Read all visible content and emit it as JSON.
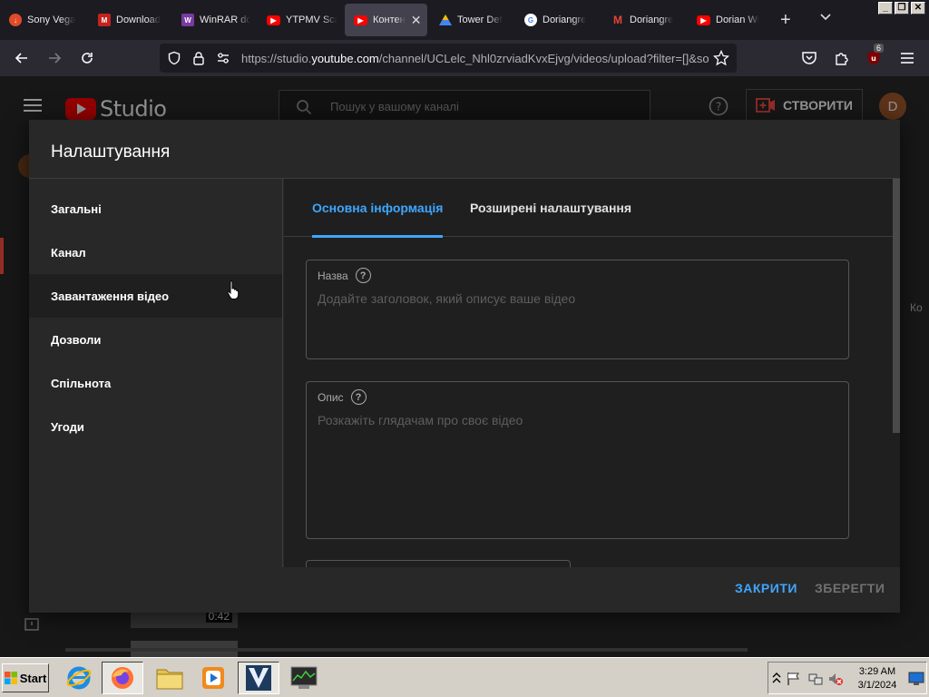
{
  "browser": {
    "tabs": [
      {
        "label": "Sony Vega",
        "fav_color": "#e04a2a",
        "fav_char": "↓"
      },
      {
        "label": "Download",
        "fav_color": "#c5221f",
        "fav_char": "M"
      },
      {
        "label": "WinRAR dc",
        "fav_color": "#7a3aa0",
        "fav_char": "W"
      },
      {
        "label": "YTPMV Sca",
        "fav_color": "#ff0000",
        "fav_char": "▶"
      },
      {
        "label": "Контен",
        "fav_color": "#ff0000",
        "fav_char": "▶",
        "active": true
      },
      {
        "label": "Tower Def",
        "fav_color": "#1e8e3e",
        "fav_char": "▲"
      },
      {
        "label": "Doriangre",
        "fav_color": "#4285f4",
        "fav_char": "G"
      },
      {
        "label": "Doriangre",
        "fav_color": "#ea4335",
        "fav_char": "M"
      },
      {
        "label": "Dorian Wi",
        "fav_color": "#ff0000",
        "fav_char": "▶"
      }
    ],
    "new_tab": "+",
    "url_prefix": "https://studio.",
    "url_domain": "youtube.com",
    "url_rest": "/channel/UCLelc_Nhl0zrviadKvxEjvg/videos/upload?filter=[]&so",
    "extension_badge": "6"
  },
  "studio": {
    "logo_text": "Studio",
    "search_placeholder": "Пошук у вашому каналі",
    "create_label": "СТВОРИТИ",
    "avatar_letter": "D",
    "side_fragment": "Ко",
    "thumb_duration": "0:42"
  },
  "modal": {
    "title": "Налаштування",
    "side_items": [
      {
        "label": "Загальні"
      },
      {
        "label": "Канал"
      },
      {
        "label": "Завантаження відео",
        "active": true
      },
      {
        "label": "Дозволи"
      },
      {
        "label": "Спільнота"
      },
      {
        "label": "Угоди"
      }
    ],
    "tabs": [
      {
        "label": "Основна інформація",
        "active": true
      },
      {
        "label": "Розширені налаштування"
      }
    ],
    "title_field": {
      "label": "Назва",
      "placeholder": "Додайте заголовок, який описує ваше відео"
    },
    "description_field": {
      "label": "Опис",
      "placeholder": "Розкажіть глядачам про своє відео"
    },
    "close_label": "ЗАКРИТИ",
    "save_label": "ЗБЕРЕГТИ"
  },
  "taskbar": {
    "start_label": "Start",
    "time": "3:29 AM",
    "date": "3/1/2024"
  },
  "colors": {
    "accent": "#3ea6ff",
    "youtube_red": "#ff0000",
    "modal_bg": "#282828",
    "content_bg": "#1f1f1f"
  }
}
